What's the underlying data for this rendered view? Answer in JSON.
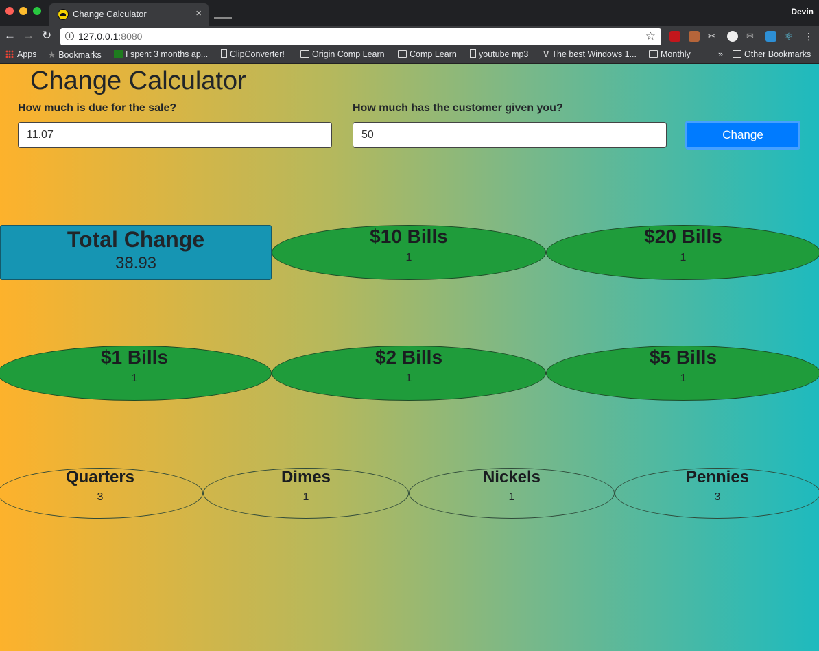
{
  "browser": {
    "tab_title": "Change Calculator",
    "tab_close": "×",
    "profile_name": "Devin",
    "url_host": "127.0.0.1",
    "url_port": ":8080",
    "bookmarks": [
      {
        "label": "Apps",
        "icon": "apps-icon"
      },
      {
        "label": "Bookmarks",
        "icon": "star-icon"
      },
      {
        "label": "I spent 3 months ap...",
        "icon": "script-icon"
      },
      {
        "label": "ClipConverter!",
        "icon": "page-icon"
      },
      {
        "label": "Origin Comp Learn",
        "icon": "folder-icon"
      },
      {
        "label": "Comp Learn",
        "icon": "folder-icon"
      },
      {
        "label": "youtube mp3",
        "icon": "page-icon"
      },
      {
        "label": "The best Windows 1...",
        "icon": "v-icon"
      },
      {
        "label": "Monthly",
        "icon": "folder-icon"
      },
      {
        "label": "»",
        "icon": "chevron-icon"
      },
      {
        "label": "Other Bookmarks",
        "icon": "folder-icon"
      }
    ]
  },
  "app": {
    "title": "Change Calculator",
    "due_label": "How much is due for the sale?",
    "due_value": "11.07",
    "given_label": "How much has the customer given you?",
    "given_value": "50",
    "button_label": "Change",
    "total_label": "Total Change",
    "total_value": "38.93",
    "denominations": [
      {
        "label": "$10 Bills",
        "count": "1"
      },
      {
        "label": "$20 Bills",
        "count": "1"
      },
      {
        "label": "$1 Bills",
        "count": "1"
      },
      {
        "label": "$2 Bills",
        "count": "1"
      },
      {
        "label": "$5 Bills",
        "count": "1"
      },
      {
        "label": "Quarters",
        "count": "3"
      },
      {
        "label": "Dimes",
        "count": "1"
      },
      {
        "label": "Nickels",
        "count": "1"
      },
      {
        "label": "Pennies",
        "count": "3"
      }
    ]
  },
  "colors": {
    "button": "#007bff",
    "total_box": "#1695b3",
    "bill_oval": "#1f9c3b",
    "gradient_start": "#fdb22c",
    "gradient_end": "#1ebabe"
  }
}
